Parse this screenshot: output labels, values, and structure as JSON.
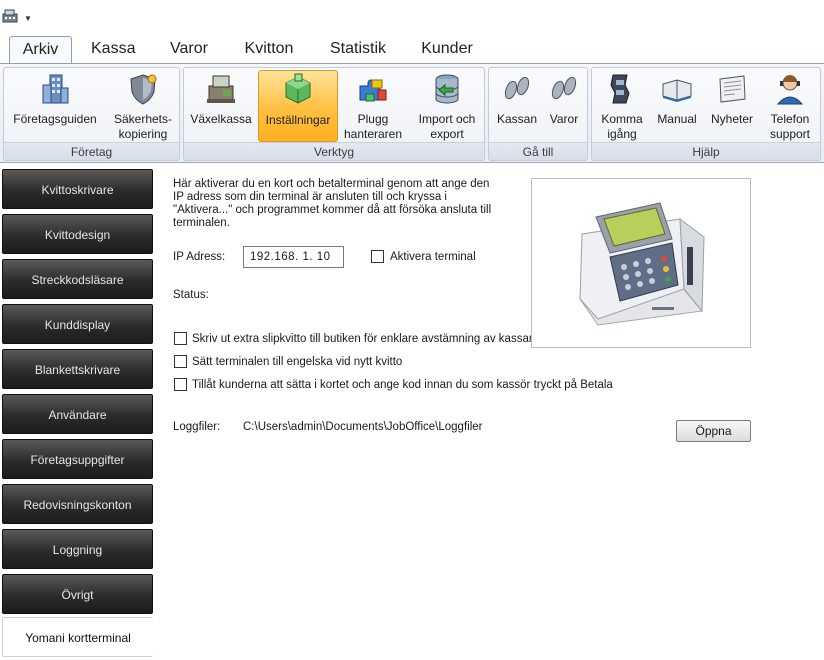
{
  "tabs": [
    {
      "label": "Arkiv",
      "active": true
    },
    {
      "label": "Kassa",
      "active": false
    },
    {
      "label": "Varor",
      "active": false
    },
    {
      "label": "Kvitton",
      "active": false
    },
    {
      "label": "Statistik",
      "active": false
    },
    {
      "label": "Kunder",
      "active": false
    }
  ],
  "ribbon": {
    "groups": {
      "foretag": "Företag",
      "verktyg": "Verktyg",
      "gatill": "Gå till",
      "hjalp": "Hjälp"
    },
    "buttons": {
      "foretagsguiden": {
        "line1": "Företagsguiden",
        "line2": "",
        "icon": "building-icon"
      },
      "sakerhetskopiering": {
        "line1": "Säkerhets-",
        "line2": "kopiering",
        "icon": "shield-icon"
      },
      "vaxelkassa": {
        "line1": "Växelkassa",
        "line2": "",
        "icon": "cash-register-icon"
      },
      "installningar": {
        "line1": "Inställningar",
        "line2": "",
        "icon": "settings-cube-icon"
      },
      "plugg": {
        "line1": "Plugg",
        "line2": "hanteraren",
        "icon": "puzzle-icon"
      },
      "import": {
        "line1": "Import och",
        "line2": "export",
        "icon": "database-icon"
      },
      "kassan": {
        "line1": "Kassan",
        "line2": "",
        "icon": "footprints-icon"
      },
      "varor": {
        "line1": "Varor",
        "line2": "",
        "icon": "footprints-icon"
      },
      "kommaigang": {
        "line1": "Komma",
        "line2": "igång",
        "icon": "film-icon"
      },
      "manual": {
        "line1": "Manual",
        "line2": "",
        "icon": "book-icon"
      },
      "nyheter": {
        "line1": "Nyheter",
        "line2": "",
        "icon": "newspaper-icon"
      },
      "telefon": {
        "line1": "Telefon",
        "line2": "support",
        "icon": "headset-person-icon"
      }
    },
    "selected_color": "#ffc040"
  },
  "sidebar": {
    "items": [
      {
        "label": "Kvittoskrivare"
      },
      {
        "label": "Kvittodesign"
      },
      {
        "label": "Streckkodsläsare"
      },
      {
        "label": "Kunddisplay"
      },
      {
        "label": "Blankettskrivare"
      },
      {
        "label": "Användare"
      },
      {
        "label": "Företagsuppgifter"
      },
      {
        "label": "Redovisningskonton"
      },
      {
        "label": "Loggning"
      },
      {
        "label": "Övrigt"
      },
      {
        "label": "Yomani kortterminal",
        "active": true
      }
    ]
  },
  "main": {
    "intro": "Här aktiverar du en kort och betalterminal genom att ange den IP adress som din terminal är ansluten till och kryssa i \"Aktivera...\" och programmet kommer då att försöka ansluta till terminalen.",
    "ip_label": "IP Adress:",
    "ip_value": "192.168.   1.  10",
    "activate_label": "Aktivera terminal",
    "status_label": "Status:",
    "option1": "Skriv ut extra slipkvitto till butiken för enklare avstämning av kassan",
    "option2": "Sätt terminalen till engelska vid nytt kvitto",
    "option3": "Tillåt kunderna att sätta i kortet och ange kod innan du som kassör tryckt på Betala",
    "log_label": "Loggfiler:",
    "log_path": "C:\\Users\\admin\\Documents\\JobOffice\\Loggfiler",
    "open_button": "Öppna",
    "photo_icon": "payment-terminal-icon"
  }
}
